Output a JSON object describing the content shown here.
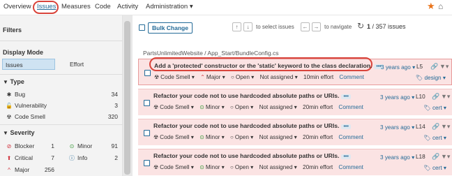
{
  "nav": {
    "items": [
      "Overview",
      "Issues",
      "Measures",
      "Code",
      "Activity",
      "Administration ▾"
    ],
    "active": "Issues"
  },
  "icons": {
    "star": "star-icon",
    "home": "home-icon"
  },
  "sidebar": {
    "filters_title": "Filters",
    "display_mode_title": "Display Mode",
    "modes": [
      "Issues",
      "Effort"
    ],
    "type_title": "Type",
    "types": [
      {
        "label": "Bug",
        "count": "34"
      },
      {
        "label": "Vulnerability",
        "count": "3"
      },
      {
        "label": "Code Smell",
        "count": "320"
      }
    ],
    "severity_title": "Severity",
    "severities_left": [
      {
        "label": "Blocker",
        "count": "1"
      },
      {
        "label": "Critical",
        "count": "7"
      },
      {
        "label": "Major",
        "count": "256"
      }
    ],
    "severities_right": [
      {
        "label": "Minor",
        "count": "91"
      },
      {
        "label": "Info",
        "count": "2"
      }
    ]
  },
  "toolbar": {
    "bulk_change": "Bulk Change",
    "select_hint": "to select issues",
    "navigate_hint": "to navigate",
    "count_current": "1",
    "count_total": "/ 357 issues"
  },
  "path": "PartsUnlimitedWebsite / App_Start/BundleConfig.cs",
  "issues": [
    {
      "message": "Add a 'protected' constructor or the 'static' keyword to the class declaration.",
      "type": "Code Smell",
      "severity": "Major",
      "status": "Open",
      "assignee": "Not assigned",
      "effort": "10min effort",
      "comment": "Comment",
      "ago": "3 years ago",
      "line": "L5",
      "tag": "design"
    },
    {
      "message": "Refactor your code not to use hardcoded absolute paths or URIs.",
      "type": "Code Smell",
      "severity": "Minor",
      "status": "Open",
      "assignee": "Not assigned",
      "effort": "20min effort",
      "comment": "Comment",
      "ago": "3 years ago",
      "line": "L10",
      "tag": "cert"
    },
    {
      "message": "Refactor your code not to use hardcoded absolute paths or URIs.",
      "type": "Code Smell",
      "severity": "Minor",
      "status": "Open",
      "assignee": "Not assigned",
      "effort": "20min effort",
      "comment": "Comment",
      "ago": "3 years ago",
      "line": "L14",
      "tag": "cert"
    },
    {
      "message": "Refactor your code not to use hardcoded absolute paths or URIs.",
      "type": "Code Smell",
      "severity": "Minor",
      "status": "Open",
      "assignee": "Not assigned",
      "effort": "20min effort",
      "comment": "Comment",
      "ago": "3 years ago",
      "line": "L18",
      "tag": "cert"
    }
  ],
  "colors": {
    "accent": "#236a97",
    "highlight_ring": "#d9443b",
    "issue_bg": "#fbe3e3"
  }
}
